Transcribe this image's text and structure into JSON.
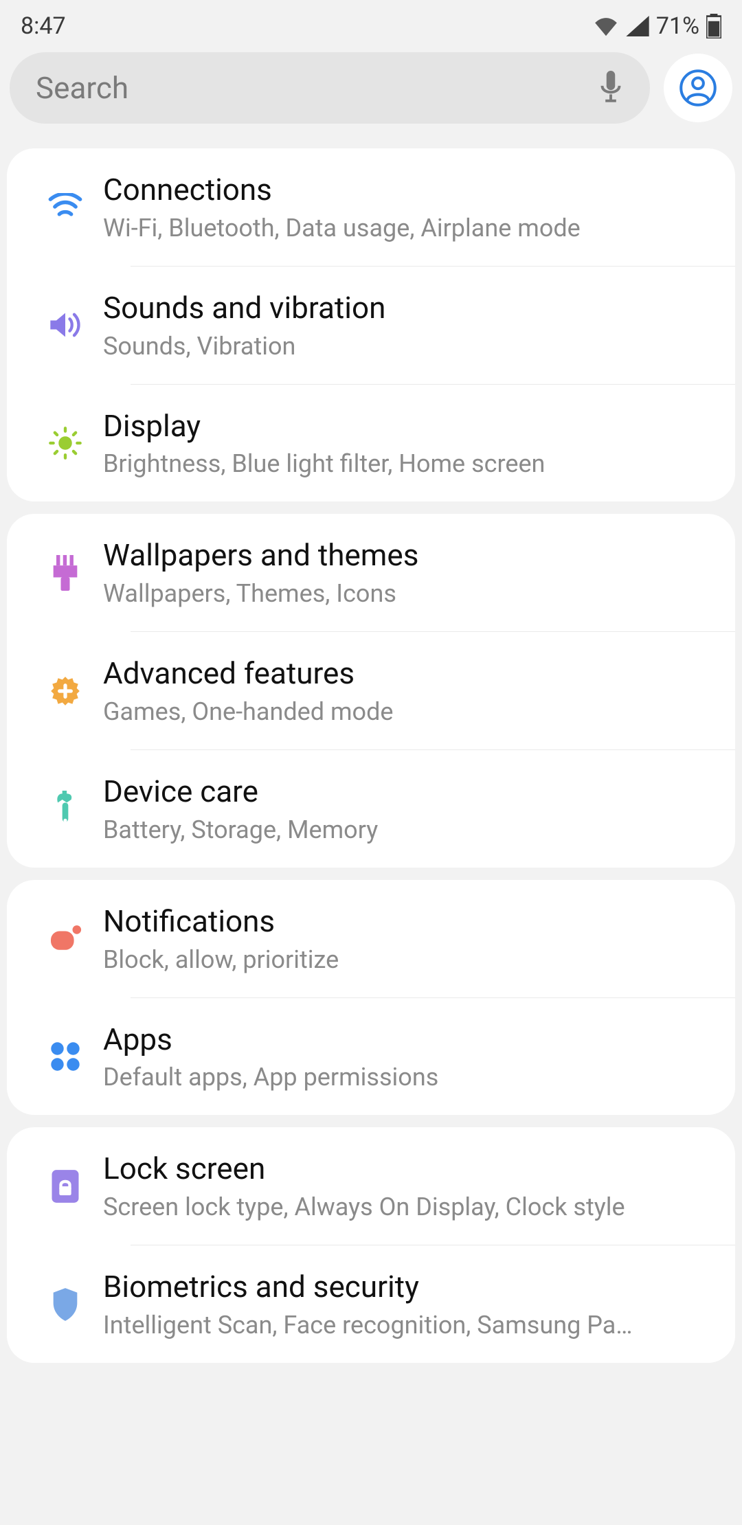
{
  "status": {
    "time": "8:47",
    "battery": "71%"
  },
  "search": {
    "placeholder": "Search"
  },
  "groups": [
    {
      "items": [
        {
          "id": "connections",
          "title": "Connections",
          "subtitle": "Wi-Fi, Bluetooth, Data usage, Airplane mode",
          "icon": "wifi-icon",
          "color": "#3a8cf0"
        },
        {
          "id": "sounds",
          "title": "Sounds and vibration",
          "subtitle": "Sounds, Vibration",
          "icon": "sound-icon",
          "color": "#8a7ae8"
        },
        {
          "id": "display",
          "title": "Display",
          "subtitle": "Brightness, Blue light filter, Home screen",
          "icon": "brightness-icon",
          "color": "#9acd32"
        }
      ]
    },
    {
      "items": [
        {
          "id": "wallpapers",
          "title": "Wallpapers and themes",
          "subtitle": "Wallpapers, Themes, Icons",
          "icon": "brush-icon",
          "color": "#c56bd4"
        },
        {
          "id": "advanced",
          "title": "Advanced features",
          "subtitle": "Games, One-handed mode",
          "icon": "gear-plus-icon",
          "color": "#f2a941"
        },
        {
          "id": "devicecare",
          "title": "Device care",
          "subtitle": "Battery, Storage, Memory",
          "icon": "wrench-icon",
          "color": "#4fc9b0"
        }
      ]
    },
    {
      "items": [
        {
          "id": "notifications",
          "title": "Notifications",
          "subtitle": "Block, allow, prioritize",
          "icon": "notification-icon",
          "color": "#f07666"
        },
        {
          "id": "apps",
          "title": "Apps",
          "subtitle": "Default apps, App permissions",
          "icon": "apps-icon",
          "color": "#3a8cf0"
        }
      ]
    },
    {
      "items": [
        {
          "id": "lockscreen",
          "title": "Lock screen",
          "subtitle": "Screen lock type, Always On Display, Clock style",
          "icon": "lock-icon",
          "color": "#9a84e8"
        },
        {
          "id": "biometrics",
          "title": "Biometrics and security",
          "subtitle": "Intelligent Scan, Face recognition, Samsung Pa…",
          "icon": "shield-icon",
          "color": "#7aa8e6"
        }
      ]
    }
  ]
}
